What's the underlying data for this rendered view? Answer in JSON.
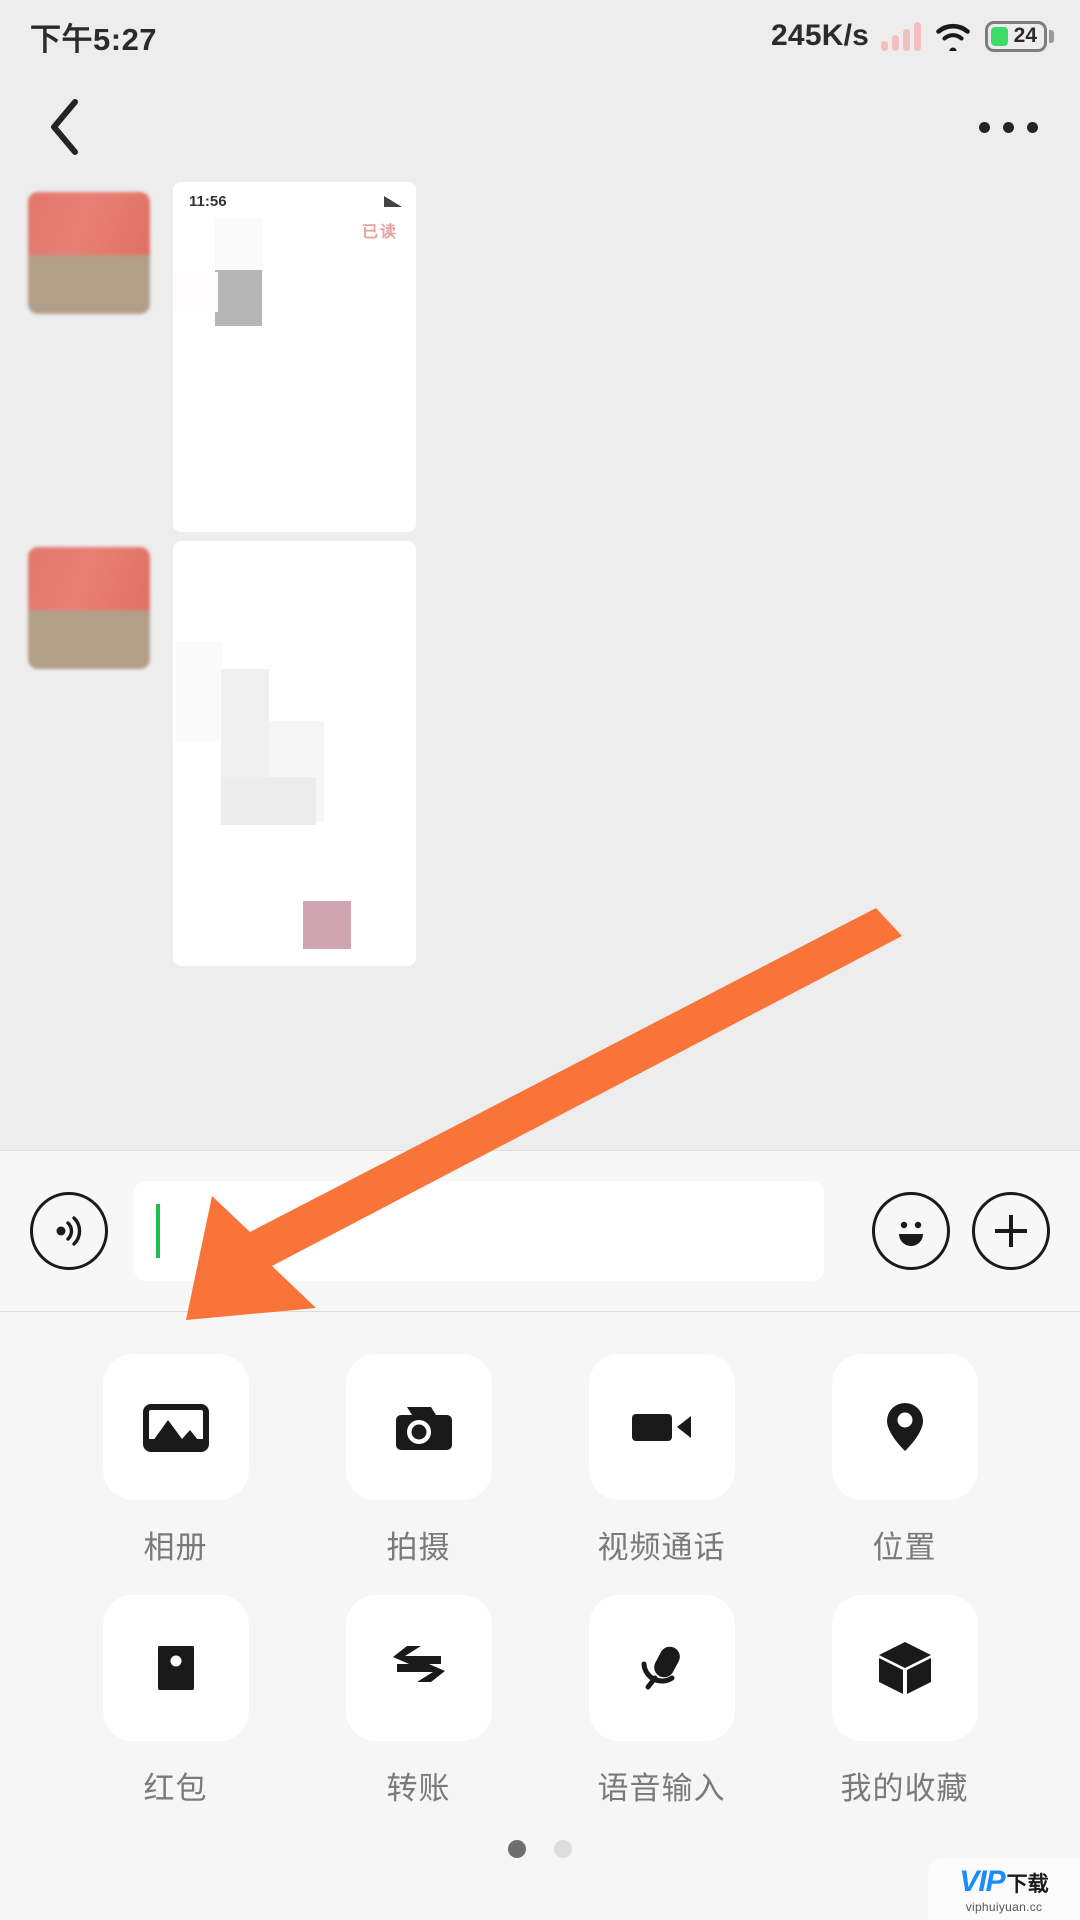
{
  "status_bar": {
    "time": "下午5:27",
    "network_speed": "245K/s",
    "battery_level": "24",
    "signal_icon": "signal-bars-icon",
    "wifi_icon": "wifi-icon",
    "battery_icon": "battery-icon",
    "colors": {
      "signal": "#f3bfbf",
      "battery_fill": "#3ddc69",
      "text": "#2b2b2b"
    }
  },
  "nav_bar": {
    "back_icon": "chevron-left-icon",
    "more_icon": "more-options-icon"
  },
  "chat": {
    "messages": [
      {
        "avatar": "contact-avatar",
        "screenshot_time": "11:56",
        "screenshot_badge": "已读"
      },
      {
        "avatar": "contact-avatar",
        "screenshot_time": "",
        "screenshot_badge": ""
      }
    ]
  },
  "input_bar": {
    "voice_icon": "voice-input-icon",
    "input_value": "",
    "input_placeholder": "",
    "emoji_icon": "emoji-icon",
    "plus_icon": "plus-icon",
    "caret_color": "#1fbd4e"
  },
  "function_panel": {
    "items": [
      {
        "label": "相册",
        "icon": "photo-album-icon"
      },
      {
        "label": "拍摄",
        "icon": "camera-icon"
      },
      {
        "label": "视频通话",
        "icon": "video-call-icon"
      },
      {
        "label": "位置",
        "icon": "location-pin-icon"
      },
      {
        "label": "红包",
        "icon": "red-packet-icon"
      },
      {
        "label": "转账",
        "icon": "transfer-icon"
      },
      {
        "label": "语音输入",
        "icon": "microphone-icon"
      },
      {
        "label": "我的收藏",
        "icon": "favorites-cube-icon"
      }
    ],
    "page_dots": {
      "total": 2,
      "active": 1
    }
  },
  "annotation": {
    "arrow_color": "#f97438",
    "arrow_target": "相册"
  },
  "watermark": {
    "logo_vip": "VIP",
    "logo_download": "下载",
    "url": "viphuiyuan.cc"
  }
}
